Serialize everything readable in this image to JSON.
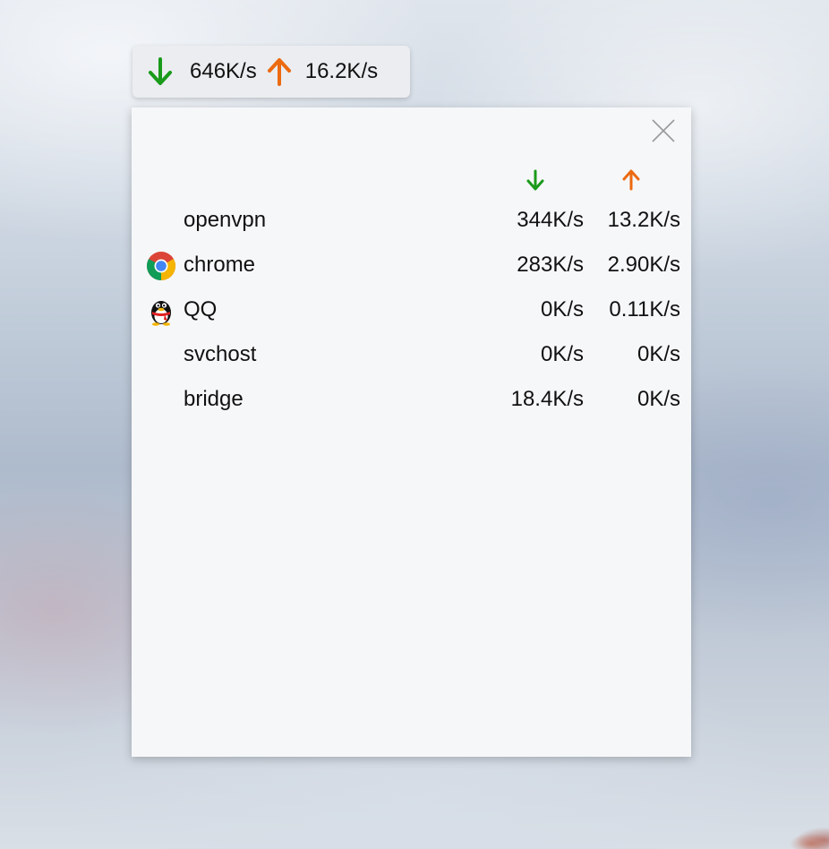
{
  "colors": {
    "download_arrow": "#1a9a1a",
    "upload_arrow": "#ec6a10",
    "panel_background": "#f6f7f9",
    "pill_background": "#ebedf0",
    "close_icon": "#9a9a9a"
  },
  "mini_widget": {
    "download_icon": "arrow-down-icon",
    "download_speed": "646K/s",
    "upload_icon": "arrow-up-icon",
    "upload_speed": "16.2K/s"
  },
  "detail_panel": {
    "close_icon": "close-icon",
    "columns": [
      {
        "key": "download",
        "icon": "arrow-down-icon"
      },
      {
        "key": "upload",
        "icon": "arrow-up-icon"
      }
    ],
    "processes": [
      {
        "name": "openvpn",
        "icon": "",
        "download": "344K/s",
        "upload": "13.2K/s"
      },
      {
        "name": "chrome",
        "icon": "chrome-icon",
        "download": "283K/s",
        "upload": "2.90K/s"
      },
      {
        "name": "QQ",
        "icon": "qq-penguin-icon",
        "download": "0K/s",
        "upload": "0.11K/s"
      },
      {
        "name": "svchost",
        "icon": "",
        "download": "0K/s",
        "upload": "0K/s"
      },
      {
        "name": "bridge",
        "icon": "",
        "download": "18.4K/s",
        "upload": "0K/s"
      }
    ]
  }
}
